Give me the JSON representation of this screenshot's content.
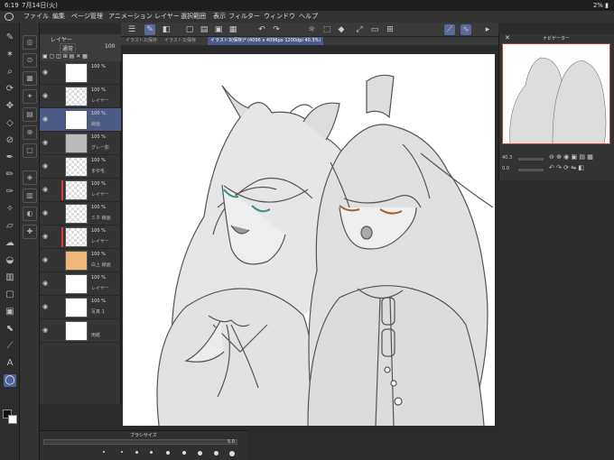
{
  "status": {
    "time": "6:19",
    "date": "7月14日(火)",
    "battery": "2%"
  },
  "menu": [
    "ファイル",
    "編集",
    "ページ管理",
    "アニメーション",
    "レイヤー",
    "選択範囲",
    "表示",
    "フィルター",
    "ウィンドウ",
    "ヘルプ"
  ],
  "layer_panel": {
    "title": "レイヤー",
    "blend": "通常",
    "opacity": "100"
  },
  "layers": [
    {
      "pct": "100 %",
      "name": ""
    },
    {
      "pct": "100 %",
      "name": "レイヤー"
    },
    {
      "pct": "100 %",
      "name": "線画"
    },
    {
      "pct": "100 %",
      "name": "グレー影"
    },
    {
      "pct": "100 %",
      "name": "まゆ毛"
    },
    {
      "pct": "100 %",
      "name": "レイヤー"
    },
    {
      "pct": "100 %",
      "name": "ミネ 線画"
    },
    {
      "pct": "100 %",
      "name": "レイヤー"
    },
    {
      "pct": "100 %",
      "name": "白上 線画"
    },
    {
      "pct": "100 %",
      "name": "レイヤー"
    },
    {
      "pct": "100 %",
      "name": "写真 1"
    },
    {
      "pct": "",
      "name": "用紙"
    }
  ],
  "tabs": [
    "イラスト2(保存",
    "イラスト3(保存",
    "イラスト3(保存)* (4096 x 4096px 1200dpi 40.3%)"
  ],
  "navigator": {
    "title": "ナビゲーター",
    "zoom": "40.3",
    "angle": "0.0"
  },
  "brush": {
    "title": "ブラシサイズ",
    "value": "5.0"
  },
  "colors": {
    "accent": "#4c5b86",
    "selection": "#d04040"
  }
}
